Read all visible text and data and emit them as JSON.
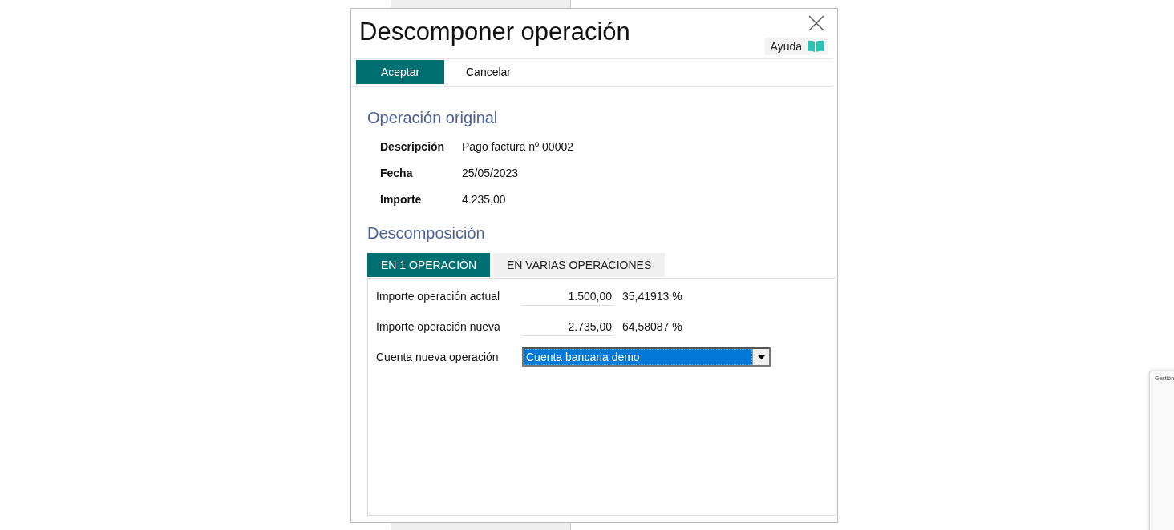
{
  "dialog": {
    "title": "Descomponer operación",
    "help_button": "Ayuda",
    "buttons": [
      {
        "label": "Aceptar",
        "kind": "primary"
      },
      {
        "label": "Cancelar",
        "kind": "plain"
      }
    ]
  },
  "original_section": {
    "heading": "Operación original",
    "fields": [
      {
        "label": "Descripción",
        "value": "Pago factura nº 00002"
      },
      {
        "label": "Fecha",
        "value": "25/05/2023"
      },
      {
        "label": "Importe",
        "value": "4.235,00"
      }
    ]
  },
  "decomposition_section": {
    "heading": "Descomposición",
    "tabs": [
      {
        "label": "EN 1 OPERACIÓN",
        "selected": true
      },
      {
        "label": "EN VARIAS OPERACIONES",
        "selected": false
      }
    ],
    "amount_rows": [
      {
        "label": "Importe operación actual",
        "value": "1.500,00",
        "percent": "35,41913 %"
      },
      {
        "label": "Importe operación nueva",
        "value": "2.735,00",
        "percent": "64,58087 %"
      }
    ],
    "account": {
      "label": "Cuenta nueva operación",
      "value": "Cuenta bancaria demo"
    }
  },
  "background_thumbnail": {
    "title": "Gestión"
  }
}
